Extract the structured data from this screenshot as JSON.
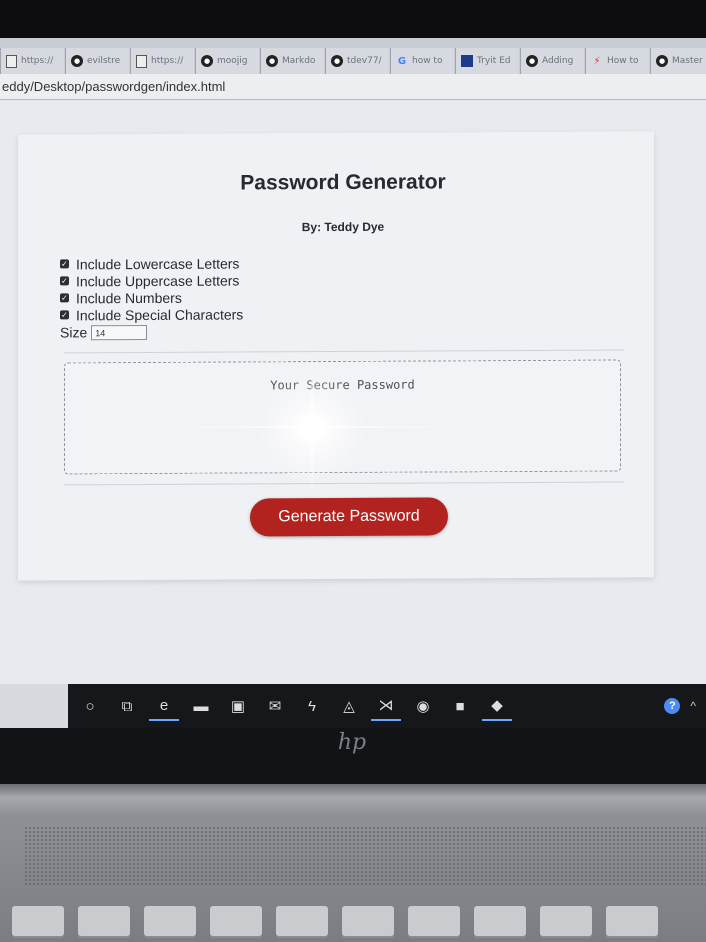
{
  "browser": {
    "tabs": [
      {
        "icon": "document-icon",
        "label": "https://"
      },
      {
        "icon": "github-icon",
        "label": "evilstre"
      },
      {
        "icon": "document-icon",
        "label": "https://"
      },
      {
        "icon": "github-icon",
        "label": "moojig"
      },
      {
        "icon": "github-icon",
        "label": "Markdo"
      },
      {
        "icon": "github-icon",
        "label": "tdev77/"
      },
      {
        "icon": "google-icon",
        "label": "how to"
      },
      {
        "icon": "square-app-icon",
        "label": "Tryit Ed"
      },
      {
        "icon": "github-icon",
        "label": "Adding"
      },
      {
        "icon": "red-app-icon",
        "label": "How to"
      },
      {
        "icon": "github-icon",
        "label": "Master"
      }
    ],
    "address": "eddy/Desktop/passwordgen/index.html"
  },
  "page": {
    "title": "Password Generator",
    "byline": "By: Teddy Dye",
    "options": [
      {
        "label": "Include Lowercase Letters",
        "checked": true
      },
      {
        "label": "Include Uppercase Letters",
        "checked": true
      },
      {
        "label": "Include Numbers",
        "checked": true
      },
      {
        "label": "Include Special Characters",
        "checked": true
      }
    ],
    "size_label": "Size",
    "size_value": "14",
    "password_placeholder": "Your Secure Password",
    "generate_button": "Generate Password"
  },
  "taskbar": {
    "icons": [
      {
        "name": "cortana-circle-icon",
        "glyph": "○"
      },
      {
        "name": "task-view-icon",
        "glyph": "⧉"
      },
      {
        "name": "edge-icon",
        "glyph": "e"
      },
      {
        "name": "file-explorer-icon",
        "glyph": "▬"
      },
      {
        "name": "store-icon",
        "glyph": "▣"
      },
      {
        "name": "mail-icon",
        "glyph": "✉"
      },
      {
        "name": "terminal-icon",
        "glyph": "ϟ"
      },
      {
        "name": "app-icon",
        "glyph": "◬"
      },
      {
        "name": "vscode-icon",
        "glyph": "⋊"
      },
      {
        "name": "chrome-icon",
        "glyph": "◉"
      },
      {
        "name": "red-app-icon",
        "glyph": "■"
      },
      {
        "name": "git-icon",
        "glyph": "◆"
      }
    ],
    "tray_chevron": "^"
  },
  "laptop": {
    "logo": "hp"
  },
  "colors": {
    "button": "#b2231f",
    "accent": "#4c8bf5"
  }
}
